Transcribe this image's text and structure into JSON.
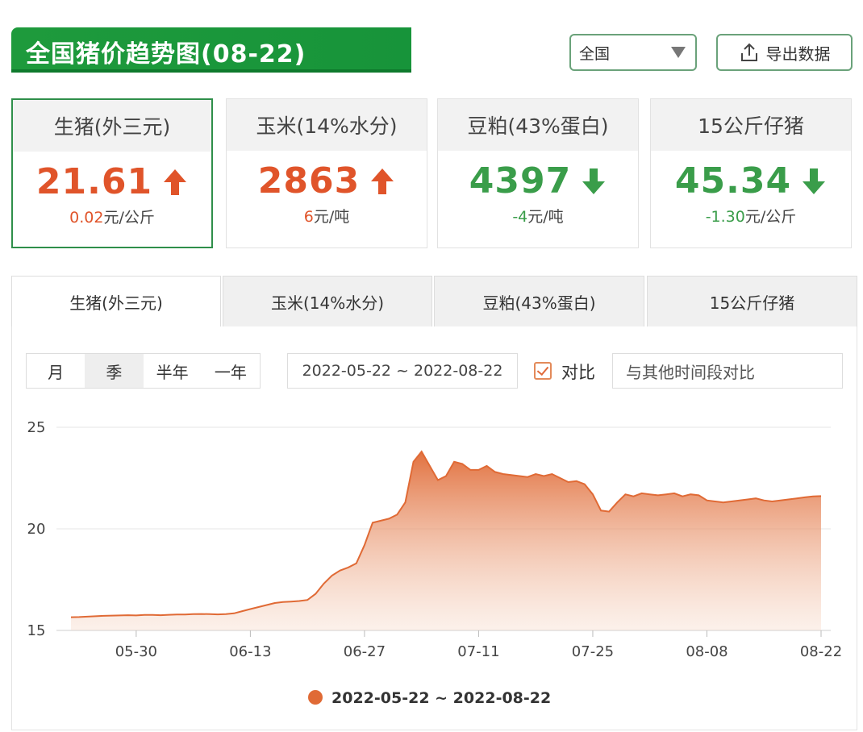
{
  "header": {
    "title": "全国猪价趋势图(08-22)",
    "region": "全国",
    "export_label": "导出数据"
  },
  "cards": [
    {
      "name": "生猪(外三元)",
      "value": "21.61",
      "change": "0.02",
      "unit": "元/公斤",
      "direction": "up"
    },
    {
      "name": "玉米(14%水分)",
      "value": "2863",
      "change": "6",
      "unit": "元/吨",
      "direction": "up"
    },
    {
      "name": "豆粕(43%蛋白)",
      "value": "4397",
      "change": "-4",
      "unit": "元/吨",
      "direction": "down"
    },
    {
      "name": "15公斤仔猪",
      "value": "45.34",
      "change": "-1.30",
      "unit": "元/公斤",
      "direction": "down"
    }
  ],
  "tabs": [
    "生猪(外三元)",
    "玉米(14%水分)",
    "豆粕(43%蛋白)",
    "15公斤仔猪"
  ],
  "controls": {
    "ranges": [
      "月",
      "季",
      "半年",
      "一年"
    ],
    "date_range": "2022-05-22 ~ 2022-08-22",
    "compare_label": "对比",
    "compare_placeholder": "与其他时间段对比"
  },
  "colors": {
    "up": "#e0542a",
    "down": "#3a9d4a",
    "brand_green": "#1e9a3c",
    "series": "#e06a35"
  },
  "chart_data": {
    "type": "area",
    "ylim": [
      15,
      25
    ],
    "yticks": [
      15,
      20,
      25
    ],
    "xticks": [
      "05-30",
      "06-13",
      "06-27",
      "07-11",
      "07-25",
      "08-08",
      "08-22"
    ],
    "grid": true,
    "legend_position": "bottom-center",
    "series": [
      {
        "name": "2022-05-22 ~ 2022-08-22",
        "x": [
          "05-22",
          "05-23",
          "05-24",
          "05-25",
          "05-26",
          "05-27",
          "05-28",
          "05-29",
          "05-30",
          "05-31",
          "06-01",
          "06-02",
          "06-03",
          "06-04",
          "06-05",
          "06-06",
          "06-07",
          "06-08",
          "06-09",
          "06-10",
          "06-11",
          "06-12",
          "06-13",
          "06-14",
          "06-15",
          "06-16",
          "06-17",
          "06-18",
          "06-19",
          "06-20",
          "06-21",
          "06-22",
          "06-23",
          "06-24",
          "06-25",
          "06-26",
          "06-27",
          "06-28",
          "06-29",
          "06-30",
          "07-01",
          "07-02",
          "07-03",
          "07-04",
          "07-05",
          "07-06",
          "07-07",
          "07-08",
          "07-09",
          "07-10",
          "07-11",
          "07-12",
          "07-13",
          "07-14",
          "07-15",
          "07-16",
          "07-17",
          "07-18",
          "07-19",
          "07-20",
          "07-21",
          "07-22",
          "07-23",
          "07-24",
          "07-25",
          "07-26",
          "07-27",
          "07-28",
          "07-29",
          "07-30",
          "07-31",
          "08-01",
          "08-02",
          "08-03",
          "08-04",
          "08-05",
          "08-06",
          "08-07",
          "08-08",
          "08-09",
          "08-10",
          "08-11",
          "08-12",
          "08-13",
          "08-14",
          "08-15",
          "08-16",
          "08-17",
          "08-18",
          "08-19",
          "08-20",
          "08-21",
          "08-22"
        ],
        "values": [
          15.65,
          15.66,
          15.68,
          15.7,
          15.72,
          15.73,
          15.74,
          15.75,
          15.74,
          15.76,
          15.76,
          15.75,
          15.77,
          15.78,
          15.78,
          15.8,
          15.81,
          15.8,
          15.79,
          15.8,
          15.84,
          15.95,
          16.05,
          16.15,
          16.25,
          16.35,
          16.4,
          16.42,
          16.45,
          16.5,
          16.8,
          17.3,
          17.7,
          17.95,
          18.1,
          18.3,
          19.2,
          20.3,
          20.4,
          20.5,
          20.7,
          21.3,
          23.3,
          23.8,
          23.1,
          22.4,
          22.6,
          23.3,
          23.2,
          22.9,
          22.9,
          23.1,
          22.8,
          22.7,
          22.65,
          22.6,
          22.55,
          22.7,
          22.6,
          22.7,
          22.5,
          22.3,
          22.35,
          22.2,
          21.7,
          20.9,
          20.85,
          21.3,
          21.7,
          21.6,
          21.75,
          21.7,
          21.65,
          21.7,
          21.75,
          21.6,
          21.7,
          21.65,
          21.4,
          21.35,
          21.3,
          21.35,
          21.4,
          21.45,
          21.5,
          21.4,
          21.35,
          21.4,
          21.45,
          21.5,
          21.55,
          21.6,
          21.61
        ]
      }
    ]
  }
}
